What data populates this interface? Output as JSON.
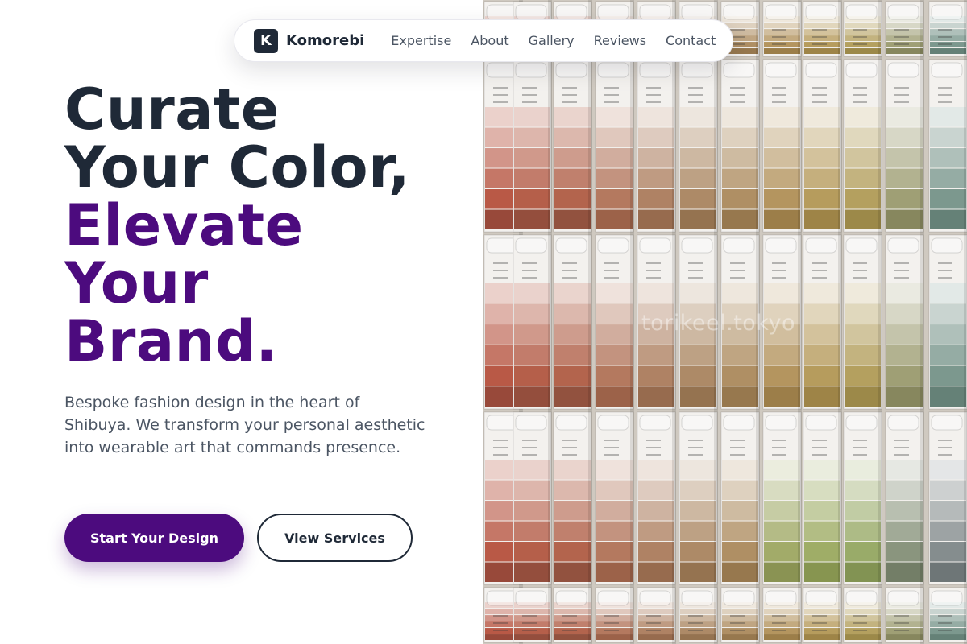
{
  "nav": {
    "logo_letter": "K",
    "brand_name": "Komorebi",
    "links": [
      {
        "label": "Expertise"
      },
      {
        "label": "About"
      },
      {
        "label": "Gallery"
      },
      {
        "label": "Reviews"
      },
      {
        "label": "Contact"
      }
    ]
  },
  "hero": {
    "headline_lines": [
      "Curate",
      "Your Color,",
      "Elevate",
      "Your",
      "Brand."
    ],
    "description": "Bespoke fashion design in the heart of Shibuya. We transform your personal aesthetic into wearable art that commands presence.",
    "primary_cta": "Start Your Design",
    "secondary_cta": "View Services",
    "image_watermark": "torikeel.tokyo"
  },
  "colors": {
    "accent": "#4c0b7e",
    "dark_text": "#1f2937",
    "body_text": "#4b5563"
  }
}
